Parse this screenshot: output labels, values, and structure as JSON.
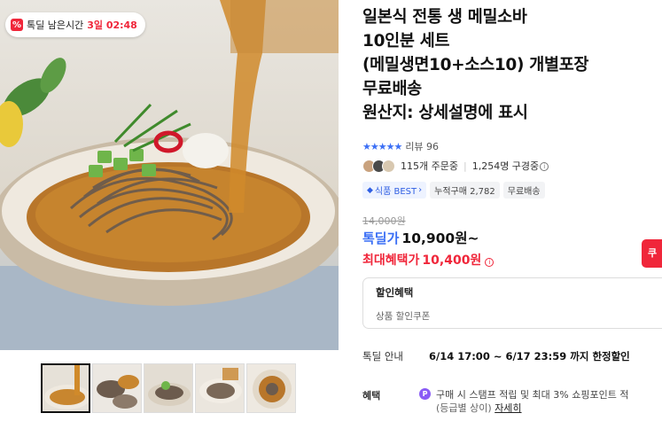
{
  "timer": {
    "label": "톡딜 남은시간",
    "time": "3일 02:48",
    "icon": "percent-icon"
  },
  "gallery": {
    "thumbnail_count": 5,
    "active_index": 0
  },
  "product": {
    "title_lines": [
      "일본식 전통 생 메밀소바",
      "10인분 세트",
      "(메밀생면10+소스10) 개별포장",
      "무료배송",
      "원산지: 상세설명에 표시"
    ]
  },
  "rating": {
    "stars": "★★★★★",
    "review_label": "리뷰 96"
  },
  "social": {
    "orders": "115개 주문중",
    "subscribers": "1,254명 구경중"
  },
  "tags": {
    "best": "식품 BEST",
    "cumulative": "누적구매 2,782",
    "free_shipping": "무료배송"
  },
  "price": {
    "original": "14,000원",
    "deal_label": "톡딜가",
    "deal_value": "10,900원~",
    "max_label": "최대혜택가",
    "max_value": "10,400원"
  },
  "coupon_button": "쿠",
  "discount": {
    "title": "할인혜택",
    "subtitle": "상품 할인쿠폰"
  },
  "deal_info": {
    "label": "톡딜 안내",
    "value": "6/14 17:00 ~ 6/17 23:59 까지 한정할인"
  },
  "benefit": {
    "label": "혜택",
    "icon_letter": "P",
    "line1": "구매 시 스탬프 적립 및 최대 3% 쇼핑포인트 적",
    "line2_paren": "(등급별 상이)",
    "line2_link": "자세히"
  },
  "colors": {
    "accent_red": "#f0263a",
    "accent_blue": "#3b6ff5",
    "point_purple": "#8a5cf5"
  }
}
